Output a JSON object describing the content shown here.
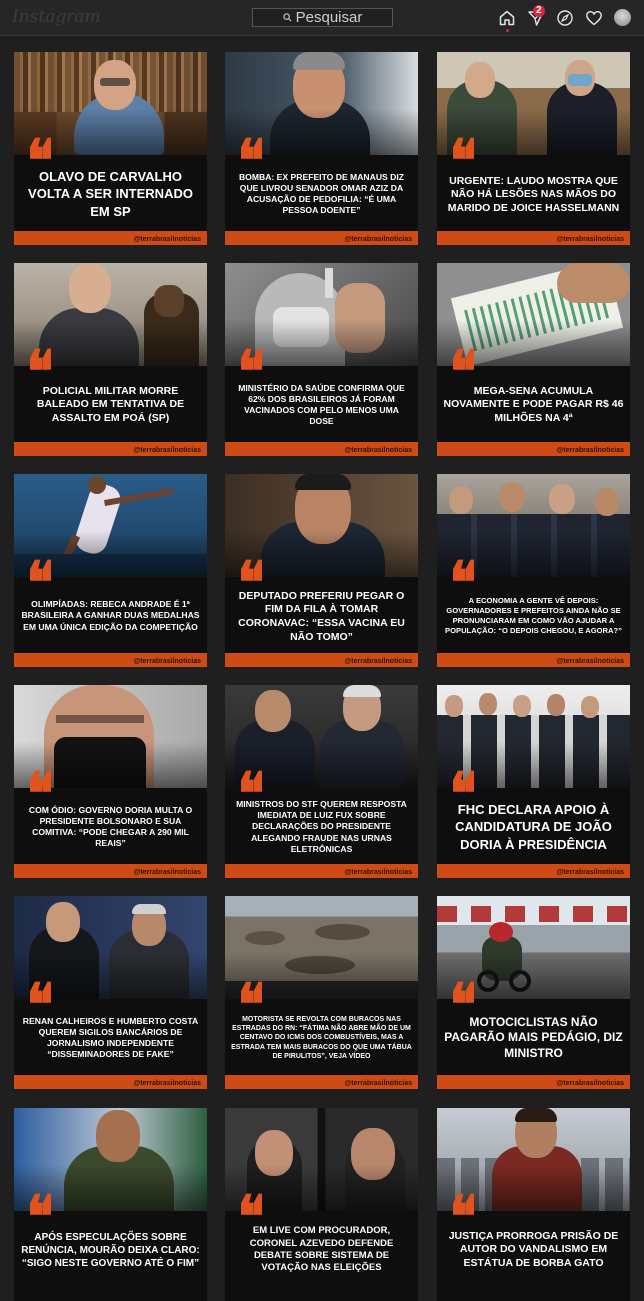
{
  "header": {
    "logo": "Instagram",
    "search_placeholder": "Pesquisar",
    "notification_count": "2"
  },
  "posts": [
    {
      "headline": "OLAVO DE CARVALHO VOLTA A SER INTERNADO EM SP",
      "handle": "@terrabrasilnoticias"
    },
    {
      "headline": "BOMBA: EX PREFEITO DE MANAUS DIZ QUE LIVROU SENADOR OMAR AZIZ DA ACUSAÇÃO DE PEDOFILIA: “É UMA PESSOA DOENTE”",
      "handle": "@terrabrasilnoticias"
    },
    {
      "headline": "URGENTE: LAUDO MOSTRA QUE NÃO HÁ LESÕES NAS MÃOS DO MARIDO DE JOICE HASSELMANN",
      "handle": "@terrabrasilnoticias"
    },
    {
      "headline": "POLICIAL MILITAR MORRE BALEADO EM TENTATIVA DE ASSALTO EM POÁ (SP)",
      "handle": "@terrabrasilnoticias"
    },
    {
      "headline": "MINISTÉRIO DA SAÚDE CONFIRMA QUE 62% DOS BRASILEIROS JÁ FORAM VACINADOS COM PELO MENOS UMA DOSE",
      "handle": "@terrabrasilnoticias"
    },
    {
      "headline": "MEGA-SENA ACUMULA NOVAMENTE E PODE PAGAR R$ 46 MILHÕES NA 4ª",
      "handle": "@terrabrasilnoticias"
    },
    {
      "headline": "OLIMPÍADAS: REBECA ANDRADE É 1ª BRASILEIRA A GANHAR DUAS MEDALHAS EM UMA ÚNICA EDIÇÃO DA COMPETIÇÃO",
      "handle": "@terrabrasilnoticias"
    },
    {
      "headline": "DEPUTADO PREFERIU PEGAR O FIM DA FILA À TOMAR CORONAVAC: “ESSA VACINA EU NÃO TOMO”",
      "handle": "@terrabrasilnoticias"
    },
    {
      "headline": "A ECONOMIA A GENTE VÊ DEPOIS: GOVERNADORES E PREFEITOS AINDA NÃO SE PRONUNCIARAM EM COMO VÃO AJUDAR A POPULAÇÃO: “O DEPOIS CHEGOU, E AGORA?”",
      "handle": "@terrabrasilnoticias"
    },
    {
      "headline": "COM ÓDIO: GOVERNO DORIA MULTA O PRESIDENTE BOLSONARO E SUA COMITIVA: “PODE CHEGAR A 290 MIL REAIS”",
      "handle": "@terrabrasilnoticias"
    },
    {
      "headline": "MINISTROS DO STF QUEREM RESPOSTA IMEDIATA DE LUIZ FUX SOBRE DECLARAÇÕES DO PRESIDENTE ALEGANDO FRAUDE NAS URNAS ELETRÔNICAS",
      "handle": "@terrabrasilnoticias"
    },
    {
      "headline": "FHC DECLARA APOIO À CANDIDATURA DE JOÃO DORIA À PRESIDÊNCIA",
      "handle": "@terrabrasilnoticias"
    },
    {
      "headline": "RENAN CALHEIROS E HUMBERTO COSTA QUEREM SIGILOS BANCÁRIOS DE JORNALISMO INDEPENDENTE “DISSEMINADORES DE FAKE”",
      "handle": "@terrabrasilnoticias"
    },
    {
      "headline": "MOTORISTA SE REVOLTA COM BURACOS NAS ESTRADAS DO RN: “FÁTIMA NÃO ABRE MÃO DE UM CENTAVO DO ICMS DOS COMBUSTÍVEIS, MAS A ESTRADA TEM MAIS BURACOS DO QUE UMA TÁBUA DE PIRULITOS”, VEJA VÍDEO",
      "handle": "@terrabrasilnoticias"
    },
    {
      "headline": "MOTOCICLISTAS NÃO PAGARÃO MAIS PEDÁGIO, DIZ MINISTRO",
      "handle": "@terrabrasilnoticias"
    },
    {
      "headline": "APÓS ESPECULAÇÕES SOBRE RENÚNCIA, MOURÃO DEIXA CLARO: “SIGO NESTE GOVERNO ATÉ O FIM”",
      "handle": ""
    },
    {
      "headline": "EM LIVE COM PROCURADOR, CORONEL AZEVEDO DEFENDE DEBATE SOBRE SISTEMA DE VOTAÇÃO NAS ELEIÇÕES",
      "handle": ""
    },
    {
      "headline": "JUSTIÇA PRORROGA PRISÃO DE AUTOR DO VANDALISMO EM ESTÁTUA DE BORBA GATO",
      "handle": ""
    }
  ]
}
